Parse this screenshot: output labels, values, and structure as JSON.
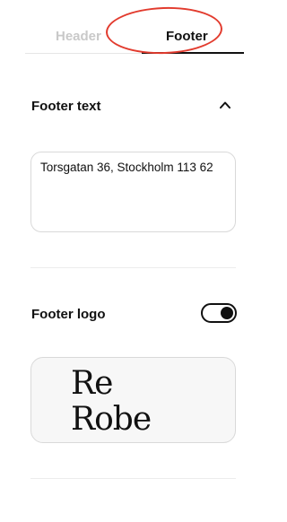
{
  "tabs": [
    {
      "label": "Header",
      "active": false
    },
    {
      "label": "Footer",
      "active": true
    }
  ],
  "footer_text": {
    "title": "Footer text",
    "value": "Torsgatan 36, Stockholm 113 62"
  },
  "footer_logo": {
    "title": "Footer logo",
    "toggle_on": true,
    "logo_text": [
      "Re",
      "Robe"
    ]
  },
  "colors": {
    "accent_circle": "#e23b2e",
    "text": "#111111",
    "inactive_tab": "#c9c9c9"
  },
  "icons": {
    "collapse": "chevron-up-icon"
  }
}
